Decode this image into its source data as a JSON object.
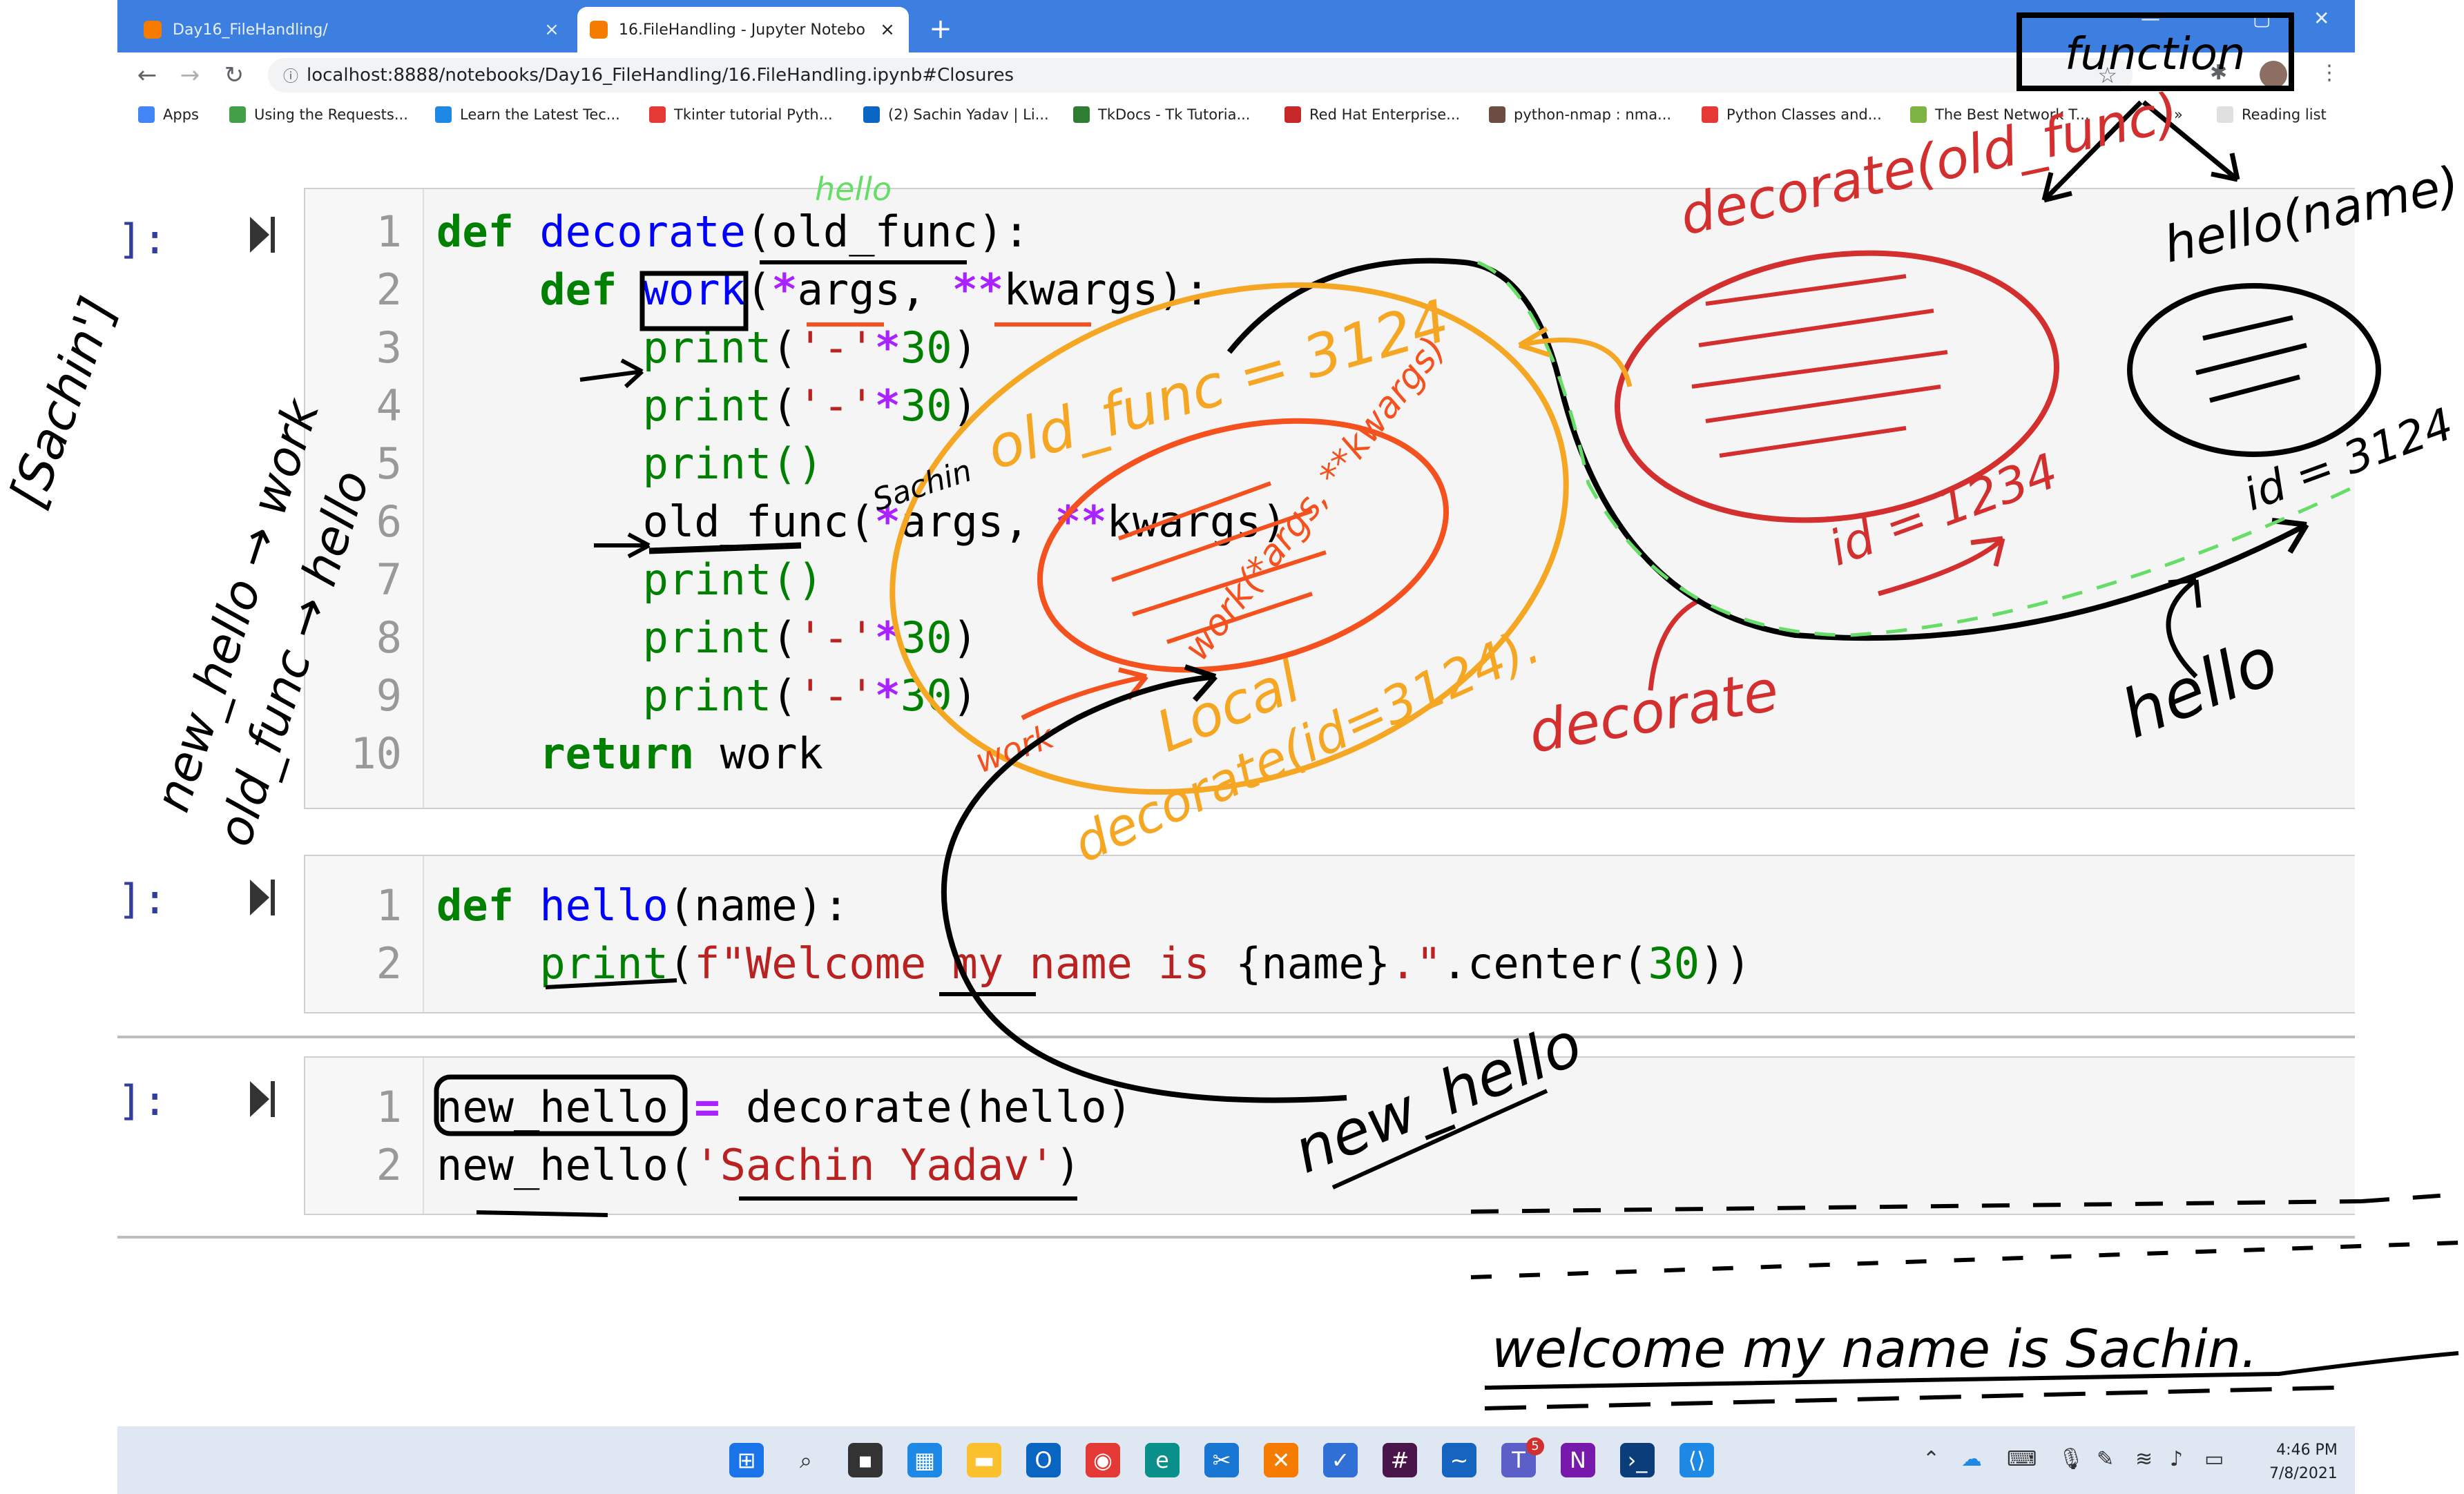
{
  "tabs": [
    {
      "title": "Day16_FileHandling/",
      "active": false
    },
    {
      "title": "16.FileHandling - Jupyter Notebo",
      "active": true
    }
  ],
  "address_bar": {
    "url": "localhost:8888/notebooks/Day16_FileHandling/16.FileHandling.ipynb#Closures"
  },
  "bookmarks": [
    {
      "label": "Apps",
      "icon": "apps-grid-icon",
      "color": "#4285f4"
    },
    {
      "label": "Using the Requests...",
      "icon": "leaf-icon",
      "color": "#43a047"
    },
    {
      "label": "Learn the Latest Tec...",
      "icon": "u-icon",
      "color": "#1e88e5"
    },
    {
      "label": "Tkinter tutorial Pyth...",
      "icon": "youtube-icon",
      "color": "#e53935"
    },
    {
      "label": "(2) Sachin Yadav | Li...",
      "icon": "linkedin-icon",
      "color": "#0a66c2"
    },
    {
      "label": "TkDocs - Tk Tutoria...",
      "icon": "tk-icon",
      "color": "#2e7d32"
    },
    {
      "label": "Red Hat Enterprise...",
      "icon": "redhat-icon",
      "color": "#c62828"
    },
    {
      "label": "python-nmap : nma...",
      "icon": "star-icon",
      "color": "#6d4c41"
    },
    {
      "label": "Python Classes and...",
      "icon": "youtube-icon",
      "color": "#e53935"
    },
    {
      "label": "The Best Network T...",
      "icon": "network-icon",
      "color": "#7cb342"
    }
  ],
  "bookmarks_more": "»",
  "reading_list": "Reading list",
  "cells": [
    {
      "prompt": "]:",
      "lines": [
        {
          "n": "1"
        },
        {
          "n": "2"
        },
        {
          "n": "3"
        },
        {
          "n": "4"
        },
        {
          "n": "5"
        },
        {
          "n": "6"
        },
        {
          "n": "7"
        },
        {
          "n": "8"
        },
        {
          "n": "9"
        },
        {
          "n": "10"
        }
      ]
    },
    {
      "prompt": "]:",
      "lines": [
        {
          "n": "1"
        },
        {
          "n": "2"
        }
      ]
    },
    {
      "prompt": "]:",
      "lines": [
        {
          "n": "1"
        },
        {
          "n": "2"
        }
      ]
    }
  ],
  "code": {
    "c1": {
      "def": "def",
      "decorate": "decorate",
      "old_func_sig": "(old_func):",
      "work": "work",
      "args_sig": "(",
      "star": "*",
      "args": "args, ",
      "dstar": "**",
      "kwargs_sig": "kwargs):",
      "print": "print",
      "dash_open": "(",
      "dash_str": "'-'",
      "dash_star": "*",
      "thirty": "30",
      "close": ")",
      "print_empty": "print()",
      "old_func_call": "old_func(",
      "args_call": "args, ",
      "kwargs_call": "kwargs)",
      "return_kw": "return",
      "return_val": " work"
    },
    "c2": {
      "def": "def",
      "hello": "hello",
      "sig": "(name):",
      "print": "print",
      "open": "(",
      "fstr": "f\"Welcome my name is ",
      "brace": "{name}",
      "fstr_end": ".\"",
      "center": ".center(",
      "thirty": "30",
      "close": "))"
    },
    "c3": {
      "new_hello": "new_hello",
      "eq": " = ",
      "decorate_call": "decorate(hello)",
      "new_hello2": "new_hello(",
      "arg": "'Sachin Yadav'",
      "close": ")"
    }
  },
  "annotations": {
    "function": "function",
    "decorate_old_func": "decorate(old_func)",
    "hello_name": "hello(name)",
    "old_func_3124": "old_func = 3124",
    "hello_small": "hello",
    "sachin": "Sachin",
    "work_kwargs": "work(*args, **kwargs)",
    "local": "Local",
    "work_small": "work",
    "decorate_id": "decorate(id=3124).",
    "id_1234": "id = 1234",
    "id_3124": "id = 3124",
    "decorate_red": "decorate",
    "hello_big": "hello",
    "new_hello_label": "new_hello",
    "left_sachin": "[Sachin']",
    "left_new_hello": "new_hello → work",
    "left_old_func": "old_func → hello",
    "output_note": "welcome my name is Sachin."
  },
  "taskbar": {
    "time": "4:46 PM",
    "date": "7/8/2021",
    "teams_badge": "5"
  },
  "colors": {
    "tab_strip": "#3d7fe0",
    "ink_black": "#000000",
    "ink_orange": "#f5a623",
    "ink_deep_orange": "#f4511e",
    "ink_red": "#d32f2f",
    "ink_green": "#66dd66"
  }
}
